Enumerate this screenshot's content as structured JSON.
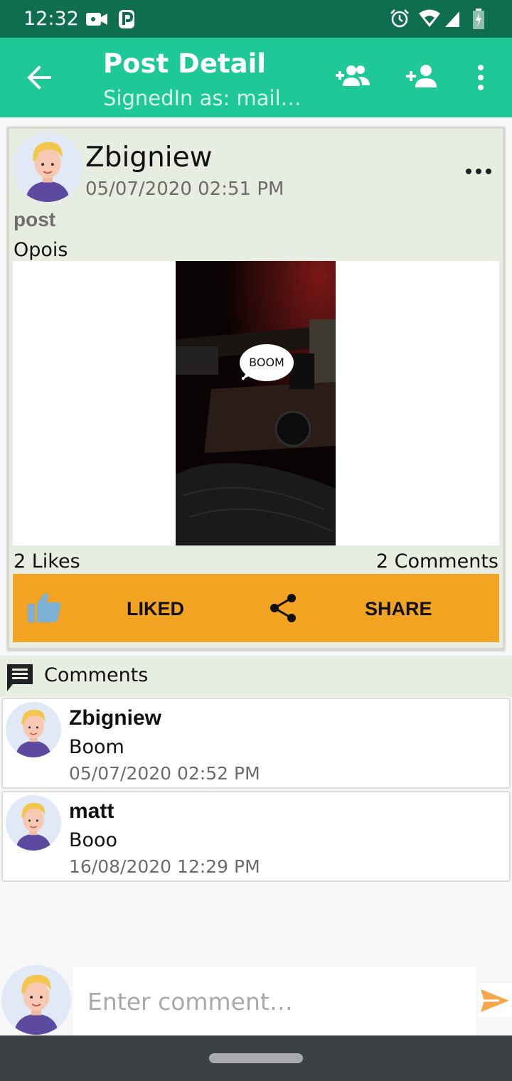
{
  "status_bar": {
    "time": "12:32",
    "icons": [
      "video-camera-icon",
      "parking-icon",
      "alarm-icon",
      "wifi-icon",
      "signal-icon",
      "battery-icon"
    ]
  },
  "app_bar": {
    "title": "Post Detail",
    "subtitle": "SignedIn as: mail…",
    "icons": [
      "back-arrow-icon",
      "add-group-icon",
      "add-person-icon",
      "overflow-menu-icon"
    ]
  },
  "post": {
    "author": "Zbigniew",
    "date": "05/07/2020 02:51 PM",
    "label": "post",
    "text": "Opois",
    "image_text": "BOOM",
    "likes": "2 Likes",
    "comments_count": "2 Comments",
    "like_label": "LIKED",
    "share_label": "SHARE"
  },
  "comments_section": {
    "title": "Comments",
    "items": [
      {
        "author": "Zbigniew",
        "text": "Boom",
        "date": "05/07/2020 02:52 PM"
      },
      {
        "author": "matt",
        "text": "Booo",
        "date": "16/08/2020 12:29 PM"
      }
    ]
  },
  "composer": {
    "placeholder": "Enter comment…"
  },
  "colors": {
    "status_bar": "#0f6e50",
    "app_bar": "#1ec997",
    "action_bar": "#f2a322",
    "card_bg": "#e8ede1",
    "send_icon": "#f5a84a"
  }
}
